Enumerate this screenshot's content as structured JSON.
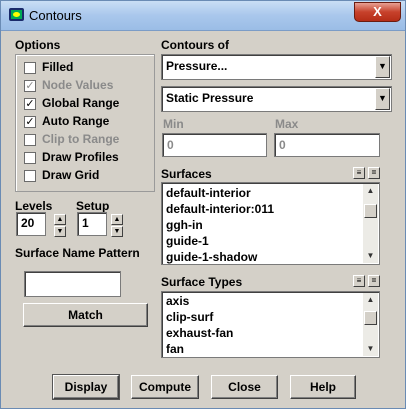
{
  "window": {
    "title": "Contours",
    "close_label": "X"
  },
  "options": {
    "heading": "Options",
    "items": [
      {
        "label": "Filled",
        "checked": false,
        "enabled": true
      },
      {
        "label": "Node Values",
        "checked": true,
        "enabled": false
      },
      {
        "label": "Global Range",
        "checked": true,
        "enabled": true
      },
      {
        "label": "Auto Range",
        "checked": true,
        "enabled": true
      },
      {
        "label": "Clip to Range",
        "checked": false,
        "enabled": false
      },
      {
        "label": "Draw Profiles",
        "checked": false,
        "enabled": true
      },
      {
        "label": "Draw Grid",
        "checked": false,
        "enabled": true
      }
    ]
  },
  "levels": {
    "label": "Levels",
    "value": "20"
  },
  "setup": {
    "label": "Setup",
    "value": "1"
  },
  "surface_name_pattern": {
    "label": "Surface Name Pattern",
    "value": "",
    "match_label": "Match"
  },
  "contours_of": {
    "label": "Contours of",
    "primary": "Pressure...",
    "secondary": "Static Pressure"
  },
  "range": {
    "min_label": "Min",
    "min_value": "0",
    "max_label": "Max",
    "max_value": "0"
  },
  "surfaces": {
    "label": "Surfaces",
    "items": [
      "default-interior",
      "default-interior:011",
      "ggh-in",
      "guide-1",
      "guide-1-shadow"
    ]
  },
  "surface_types": {
    "label": "Surface Types",
    "items": [
      "axis",
      "clip-surf",
      "exhaust-fan",
      "fan"
    ]
  },
  "buttons": {
    "display": "Display",
    "compute": "Compute",
    "close": "Close",
    "help": "Help"
  },
  "list_buttons": {
    "select_all": "≡",
    "deselect_all": "="
  },
  "checkmark": "✓",
  "arrows": {
    "down": "▼",
    "up": "▲"
  }
}
